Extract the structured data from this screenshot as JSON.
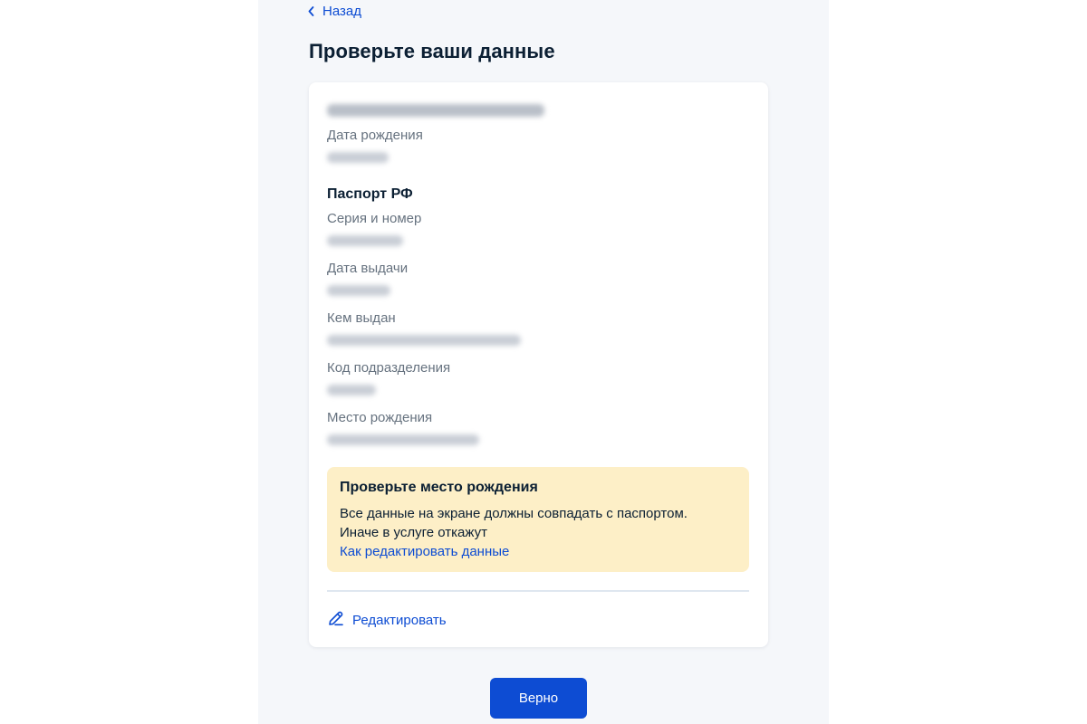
{
  "nav": {
    "back_label": "Назад"
  },
  "title": "Проверьте ваши данные",
  "person": {
    "birth_date_label": "Дата рождения"
  },
  "passport": {
    "section_title": "Паспорт РФ",
    "series_number_label": "Серия и номер",
    "issue_date_label": "Дата выдачи",
    "issued_by_label": "Кем выдан",
    "division_code_label": "Код подразделения",
    "birth_place_label": "Место рождения"
  },
  "warning": {
    "title": "Проверьте место рождения",
    "text": "Все данные на экране должны совпадать с паспортом. Иначе в услуге откажут",
    "link": "Как редактировать данные"
  },
  "edit_label": "Редактировать",
  "confirm_label": "Верно",
  "colors": {
    "accent": "#0d4cd3",
    "warning_bg": "#fdefc7",
    "page_bg": "#f5f7fa"
  },
  "icons": [
    "chevron-left-icon",
    "pencil-icon"
  ]
}
